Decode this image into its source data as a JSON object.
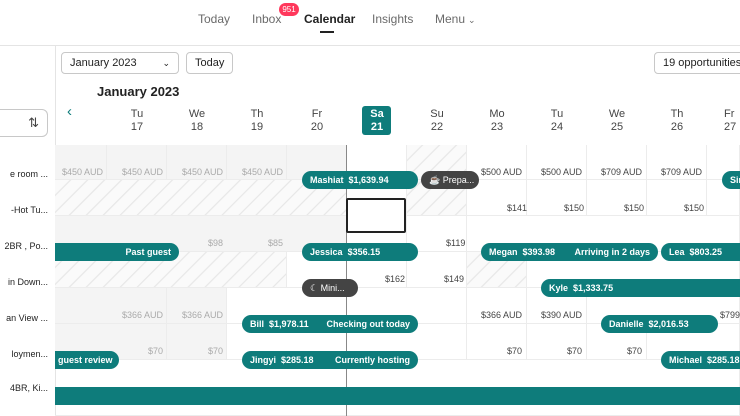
{
  "nav": {
    "today": "Today",
    "inbox": "Inbox",
    "inbox_badge": "951",
    "calendar": "Calendar",
    "insights": "Insights",
    "menu": "Menu"
  },
  "toolbar": {
    "month_select": "January 2023",
    "today_button": "Today",
    "opportunities": "19 opportunities",
    "month_title": "January 2023"
  },
  "days": [
    {
      "dow": "Tu",
      "num": "17"
    },
    {
      "dow": "We",
      "num": "18"
    },
    {
      "dow": "Th",
      "num": "19"
    },
    {
      "dow": "Fr",
      "num": "20"
    },
    {
      "dow": "Sa",
      "num": "21"
    },
    {
      "dow": "Su",
      "num": "22"
    },
    {
      "dow": "Mo",
      "num": "23"
    },
    {
      "dow": "Tu",
      "num": "24"
    },
    {
      "dow": "We",
      "num": "25"
    },
    {
      "dow": "Th",
      "num": "26"
    },
    {
      "dow": "Fr",
      "num": "27"
    }
  ],
  "listings": [
    "e room ...",
    "-Hot Tu...",
    "2BR , Po...",
    "in Down...",
    "an View ...",
    "loymen...",
    "4BR, Ki..."
  ],
  "prices": {
    "r0": [
      "$450 AUD",
      "$450 AUD",
      "$450 AUD",
      "$450 AUD",
      "$500 AUD",
      "$500 AUD",
      "$709 AUD",
      "$709 AUD"
    ],
    "r1": [
      "$141",
      "$150",
      "$150",
      "$150"
    ],
    "r2": [
      "$98",
      "$85",
      "$119"
    ],
    "r3": [
      "$162",
      "$149"
    ],
    "r4": [
      "$366 AUD",
      "$366 AUD",
      "$366 AUD",
      "$390 AUD",
      "$799"
    ],
    "r5": [
      "$70",
      "$70",
      "$70",
      "$70",
      "$70"
    ]
  },
  "reservations": {
    "mashiat": {
      "name": "Mashiat",
      "amount": "$1,639.94"
    },
    "prepa": {
      "name": "Prepa..."
    },
    "sim": {
      "name": "Sim"
    },
    "past_guest": {
      "label": "Past guest"
    },
    "jessica": {
      "name": "Jessica",
      "amount": "$356.15"
    },
    "megan": {
      "name": "Megan",
      "amount": "$393.98",
      "status": "Arriving in 2 days"
    },
    "lea": {
      "name": "Lea",
      "amount": "$803.25"
    },
    "mini": {
      "name": "Mini..."
    },
    "kyle": {
      "name": "Kyle",
      "amount": "$1,333.75"
    },
    "bill": {
      "name": "Bill",
      "amount": "$1,978.11",
      "status": "Checking out today"
    },
    "danielle": {
      "name": "Danielle",
      "amount": "$2,016.53"
    },
    "guest_review": {
      "label": "guest review"
    },
    "jingyi": {
      "name": "Jingyi",
      "amount": "$285.18",
      "status": "Currently hosting"
    },
    "michael": {
      "name": "Michael",
      "amount": "$285.18"
    }
  },
  "colors": {
    "accent": "#0e7c7b",
    "badge": "#ff385c"
  }
}
